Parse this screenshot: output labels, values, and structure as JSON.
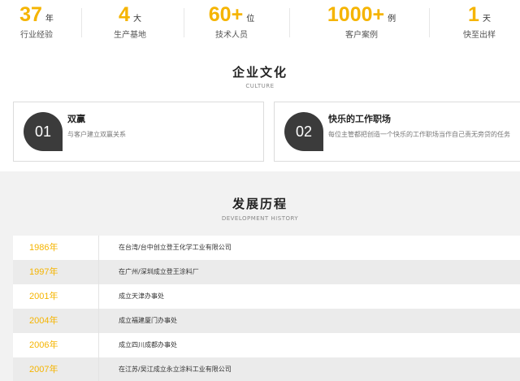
{
  "stats": [
    {
      "num": "37",
      "unit": "年",
      "label": "行业经验"
    },
    {
      "num": "4",
      "unit": "大",
      "label": "生产基地"
    },
    {
      "num": "60+",
      "unit": "位",
      "label": "技术人员"
    },
    {
      "num": "1000+",
      "unit": "例",
      "label": "客户案例"
    },
    {
      "num": "1",
      "unit": "天",
      "label": "快至出样"
    }
  ],
  "culture": {
    "title": "企业文化",
    "subtitle": "CULTURE",
    "cards": [
      {
        "num": "01",
        "title": "双赢",
        "desc": "与客户建立双赢关系"
      },
      {
        "num": "02",
        "title": "快乐的工作职场",
        "desc": "每位主管都把创造一个快乐的工作职场当作自己责无旁贷的任务"
      }
    ]
  },
  "history": {
    "title": "发展历程",
    "subtitle": "DEVELOPMENT HISTORY",
    "rows": [
      {
        "year": "1986年",
        "event": "在台湾/台中创立登王化学工业有限公司"
      },
      {
        "year": "1997年",
        "event": "在广州/深圳成立登王涂料厂"
      },
      {
        "year": "2001年",
        "event": "成立天津办事处"
      },
      {
        "year": "2004年",
        "event": "成立福建厦门办事处"
      },
      {
        "year": "2006年",
        "event": "成立四川成都办事处"
      },
      {
        "year": "2007年",
        "event": "在江苏/吴江成立永立涂料工业有限公司"
      }
    ]
  },
  "colors": {
    "accent": "#f5b400",
    "badge": "#3b3b3b",
    "history_bg": "#f2f2f2"
  }
}
